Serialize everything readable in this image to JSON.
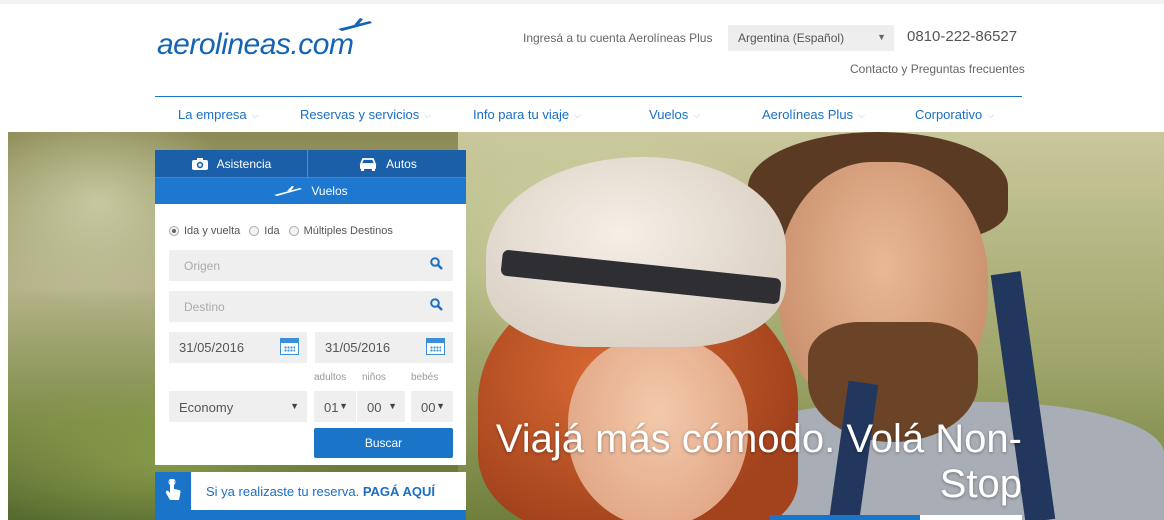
{
  "header": {
    "logo_text": "aerolineas.com",
    "account_link": "Ingresá a tu cuenta Aerolíneas Plus",
    "country_select": {
      "value": "Argentina (Español)"
    },
    "phone": "0810-222-86527",
    "contact_link": "Contacto y Preguntas frecuentes"
  },
  "nav": {
    "items": [
      {
        "label": "La empresa"
      },
      {
        "label": "Reservas y servicios"
      },
      {
        "label": "Info para tu viaje"
      },
      {
        "label": "Vuelos"
      },
      {
        "label": "Aerolíneas Plus"
      },
      {
        "label": "Corporativo"
      }
    ]
  },
  "booking": {
    "tabs": {
      "assist": "Asistencia",
      "cars": "Autos",
      "flights": "Vuelos"
    },
    "trip_types": {
      "round": "Ida y vuelta",
      "oneway": "Ida",
      "multi": "Múltiples Destinos",
      "selected": "round"
    },
    "origin_placeholder": "Origen",
    "destination_placeholder": "Destino",
    "date_depart": "31/05/2016",
    "date_return": "31/05/2016",
    "pax_labels": {
      "adults": "adultos",
      "children": "niños",
      "infants": "bebés"
    },
    "cabin": "Economy",
    "adults": "01",
    "children": "00",
    "infants": "00",
    "search_button": "Buscar"
  },
  "pay_banner": {
    "text": "Si ya realizaste tu reserva.",
    "cta": "PAGÁ AQUÍ"
  },
  "hero": {
    "headline_line1": "Viajá más cómodo. Volá Non-",
    "headline_line2": "Stop"
  },
  "colors": {
    "brand_blue": "#1a75c9",
    "nav_text": "#1a6fc4"
  }
}
